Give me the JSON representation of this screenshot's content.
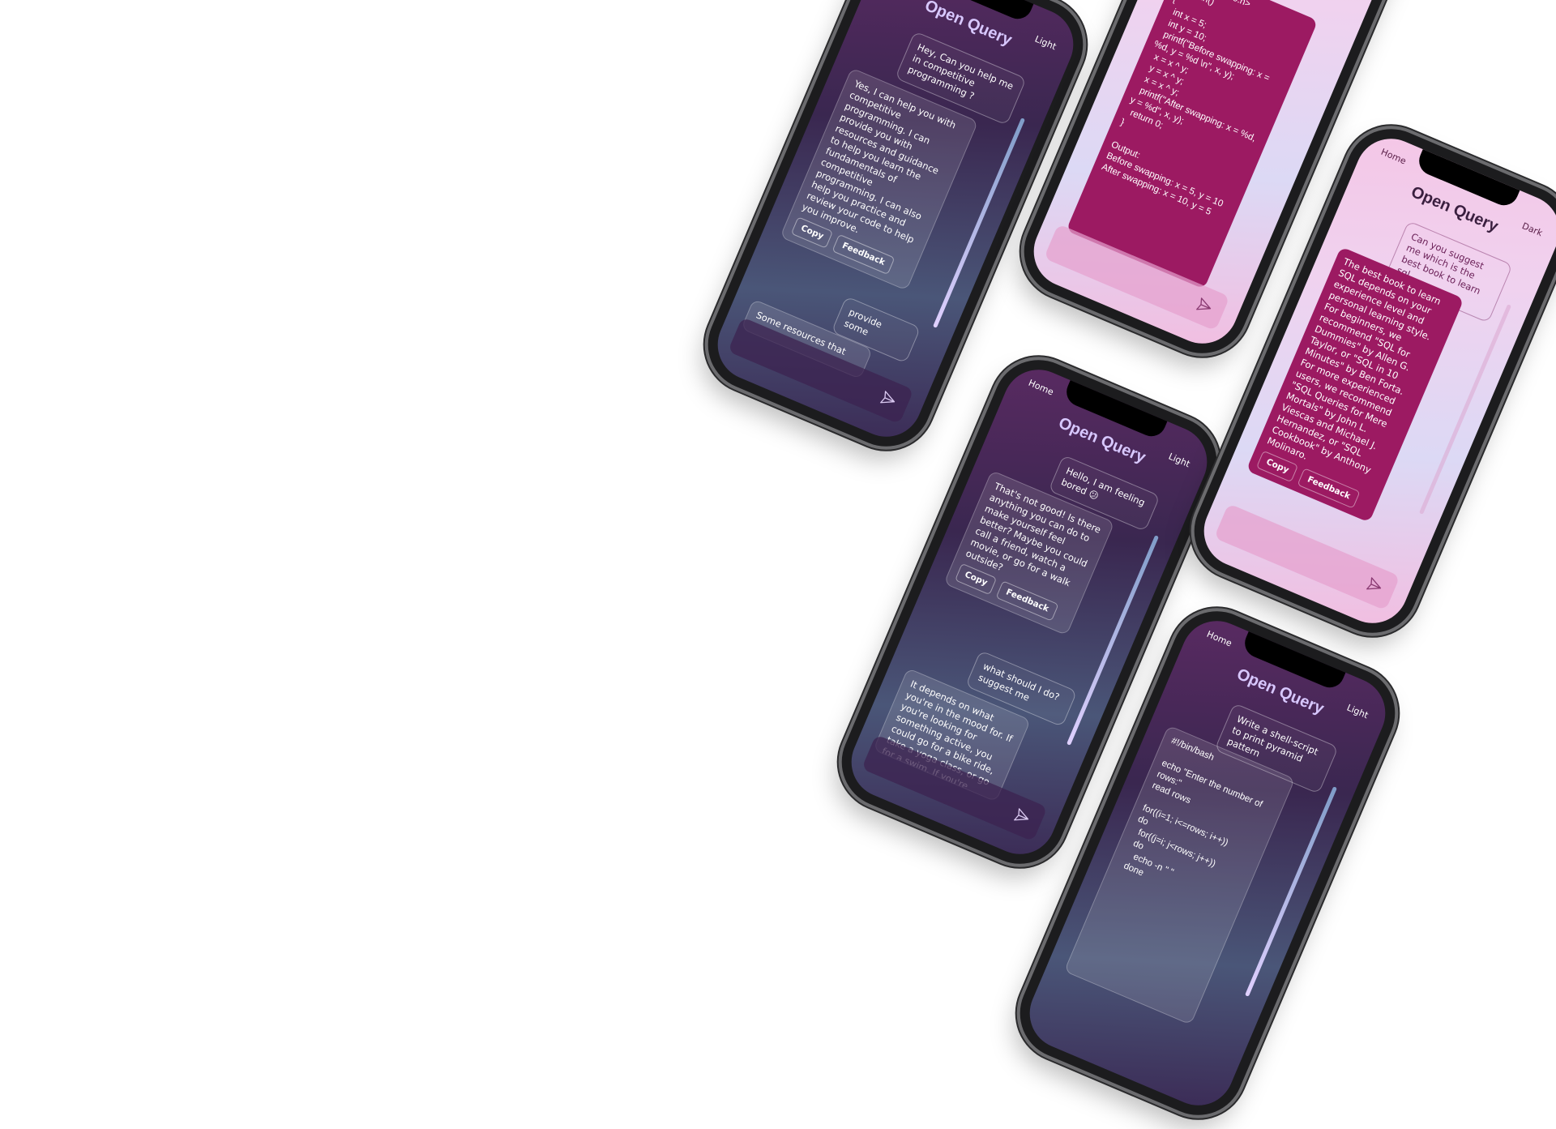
{
  "app": {
    "title": "Open Query",
    "home": "Home",
    "light": "Light",
    "dark": "Dark"
  },
  "phone1": {
    "user1": "Hey, Can you help me in competitive programming ?",
    "bot1": "Yes, I can help you with competitive programming. I can provide you with resources and guidance to help you learn the fundamentals of competitive programming. I can also help you practice and review your code to help you improve.",
    "user2": "provide some",
    "bot2": "Some resources that"
  },
  "phone2": {
    "code": "#include<stdio.h>\nint main()\n{\n  int x = 5;\n  int y = 10;\n  printf(\"Before swapping: x = %d, y = %d \\n\", x, y);\n  x = x ^ y;\n  y = x ^ y;\n  x = x ^ y;\n  printf(\"After swapping: x = %d, y = %d\", x, y);\n  return 0;\n}\n\nOutput:\nBefore swapping: x = 5, y = 10\nAfter swapping: x = 10, y = 5"
  },
  "phone3": {
    "user1": "Hello, I am feeling bored 😕",
    "bot1": "That's not good! Is there anything you can do to make yourself feel better? Maybe you could call a friend, watch a movie, or go for a walk outside?",
    "user2": "what should I do? suggest me",
    "bot2": "It depends on what you're in the mood for. If you're looking for something active, you could go for a bike ride, take a yoga class, or go for a swim. If you're"
  },
  "phone4": {
    "user1": "Can you suggest me which is the best book to learn sql",
    "bot1": "The best book to learn SQL depends on your experience level and personal learning style. For beginners, we recommend \"SQL for Dummies\" by Allen G. Taylor, or \"SQL in 10 Minutes\" by Ben Forta. For more experienced users, we recommend \"SQL Queries for Mere Mortals\" by John L. Viescas and Michael J. Hernandez, or \"SQL Cookbook\" by Anthony Molinaro."
  },
  "phone5": {
    "user1": "Write a shell-script to print pyramid pattern",
    "code": "#!/bin/bash\n\necho \"Enter the number of rows:\"\nread rows\n\nfor((i=1; i<=rows; i++))\ndo\n  for((j=i; j<rows; j++))\n  do\n    echo -n \" \"\n  done"
  },
  "buttons": {
    "copy": "Copy",
    "feedback": "Feedback"
  }
}
